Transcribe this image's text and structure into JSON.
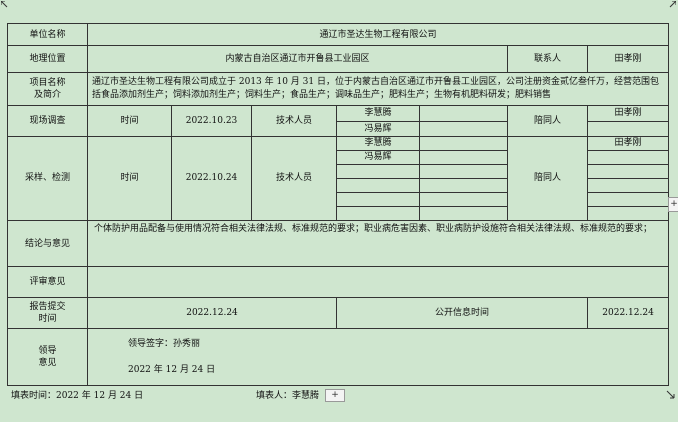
{
  "form": {
    "row1": {
      "label": "单位名称",
      "value": "通辽市圣达生物工程有限公司"
    },
    "row2": {
      "label": "地理位置",
      "value": "内蒙古自治区通辽市开鲁县工业园区",
      "contact_label": "联系人",
      "contact_value": "田孝刚"
    },
    "row3": {
      "label_line1": "项目名称",
      "label_line2": "及简介",
      "value": "通辽市圣达生物工程有限公司成立于 2013 年 10 月 31 日，位于内蒙古自治区通辽市开鲁县工业园区，公司注册资金贰亿叁仟万，经营范围包括食品添加剂生产；饲料添加剂生产；饲料生产；食品生产；调味品生产；肥料生产；生物有机肥料研发；肥料销售"
    },
    "survey": {
      "label": "现场调查",
      "time_label": "时间",
      "date": "2022.10.23",
      "tech_label": "技术人员",
      "techs": [
        "李慧腾",
        "冯易辉"
      ],
      "accompany_label": "陪同人",
      "accompany": [
        "田孝刚",
        ""
      ]
    },
    "sampling": {
      "label": "采样、检测",
      "time_label": "时间",
      "date": "2022.10.24",
      "tech_label": "技术人员",
      "techs": [
        "李慧腾",
        "冯易辉",
        "",
        "",
        "",
        ""
      ],
      "accompany_label": "陪同人",
      "accompany": [
        "田孝刚",
        "",
        "",
        "",
        "",
        ""
      ]
    },
    "conclusion": {
      "label": "结论与意见",
      "value": "个体防护用品配备与使用情况符合相关法律法规、标准规范的要求；职业病危害因素、职业病防护设施符合相关法律法规、标准规范的要求；"
    },
    "review": {
      "label": "评审意见",
      "value": ""
    },
    "report": {
      "label_line1": "报告提交",
      "label_line2": "时间",
      "date": "2022.12.24",
      "public_label": "公开信息时间",
      "public_date": "2022.12.24"
    },
    "leader": {
      "label_line1": "领导",
      "label_line2": "意见",
      "signature": "领导签字：孙秀丽",
      "date": "2022 年 12 月 24 日"
    }
  },
  "footer": {
    "fill_time": "填表时间：2022 年 12 月 24 日",
    "filler": "填表人：李慧腾",
    "add_button": "+"
  },
  "side_button": "+",
  "icons": [
    "corner-arrow-icon",
    "corner-arrow-icon",
    "resize-arrow-icon"
  ]
}
